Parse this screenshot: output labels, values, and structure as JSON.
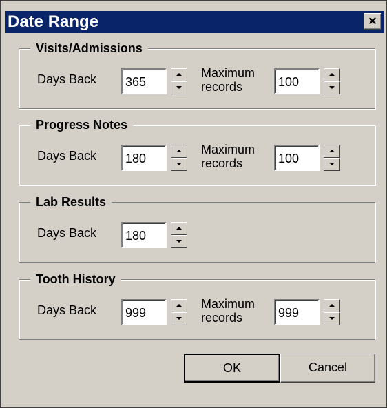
{
  "window": {
    "title": "Date Range",
    "close_label": "×"
  },
  "groups": {
    "visits": {
      "title": "Visits/Admissions",
      "days_label": "Days Back",
      "days_value": "365",
      "max_label_line1": "Maximum",
      "max_label_line2": "records",
      "max_value": "100"
    },
    "progress": {
      "title": "Progress Notes",
      "days_label": "Days Back",
      "days_value": "180",
      "max_label_line1": "Maximum",
      "max_label_line2": "records",
      "max_value": "100"
    },
    "lab": {
      "title": "Lab Results",
      "days_label": "Days Back",
      "days_value": "180"
    },
    "tooth": {
      "title": "Tooth History",
      "days_label": "Days Back",
      "days_value": "999",
      "max_label_line1": "Maximum",
      "max_label_line2": "records",
      "max_value": "999"
    }
  },
  "buttons": {
    "ok": "OK",
    "cancel": "Cancel"
  },
  "colors": {
    "titlebar": "#0a246a",
    "face": "#d4d0c8"
  }
}
